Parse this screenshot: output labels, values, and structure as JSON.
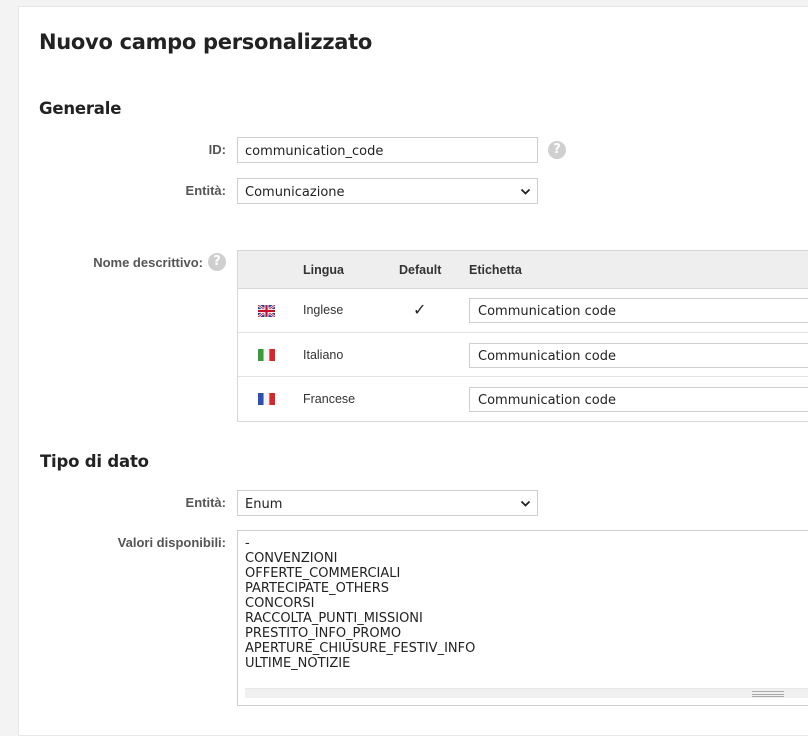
{
  "page": {
    "title": "Nuovo campo personalizzato"
  },
  "general": {
    "heading": "Generale",
    "id_label": "ID:",
    "id_value": "communication_code",
    "entity_label": "Entità:",
    "entity_value": "Comunicazione",
    "descriptive_name_label": "Nome descrittivo:"
  },
  "translations": {
    "columns": {
      "language": "Lingua",
      "default": "Default",
      "label": "Etichetta"
    },
    "rows": [
      {
        "flag": "uk-flag-icon",
        "language": "Inglese",
        "is_default": true,
        "default_mark": "✓",
        "label": "Communication code"
      },
      {
        "flag": "italy-flag-icon",
        "language": "Italiano",
        "is_default": false,
        "default_mark": "",
        "label": "Communication code"
      },
      {
        "flag": "france-flag-icon",
        "language": "Francese",
        "is_default": false,
        "default_mark": "",
        "label": "Communication code"
      }
    ]
  },
  "datatype": {
    "heading": "Tipo di dato",
    "entity_label": "Entità:",
    "entity_value": "Enum",
    "values_label": "Valori disponibili:",
    "values": [
      "-",
      "CONVENZIONI",
      "OFFERTE_COMMERCIALI",
      "PARTECIPATE_OTHERS",
      "CONCORSI",
      "RACCOLTA_PUNTI_MISSIONI",
      "PRESTITO_INFO_PROMO",
      "APERTURE_CHIUSURE_FESTIV_INFO",
      "ULTIME_NOTIZIE"
    ]
  },
  "colors": {
    "help_icon": "#cfcfcf",
    "header_bg": "#eeeeee",
    "border": "#cfcfcf"
  },
  "icons": {
    "help": "question-icon",
    "dropdown": "chevron-down-icon"
  }
}
